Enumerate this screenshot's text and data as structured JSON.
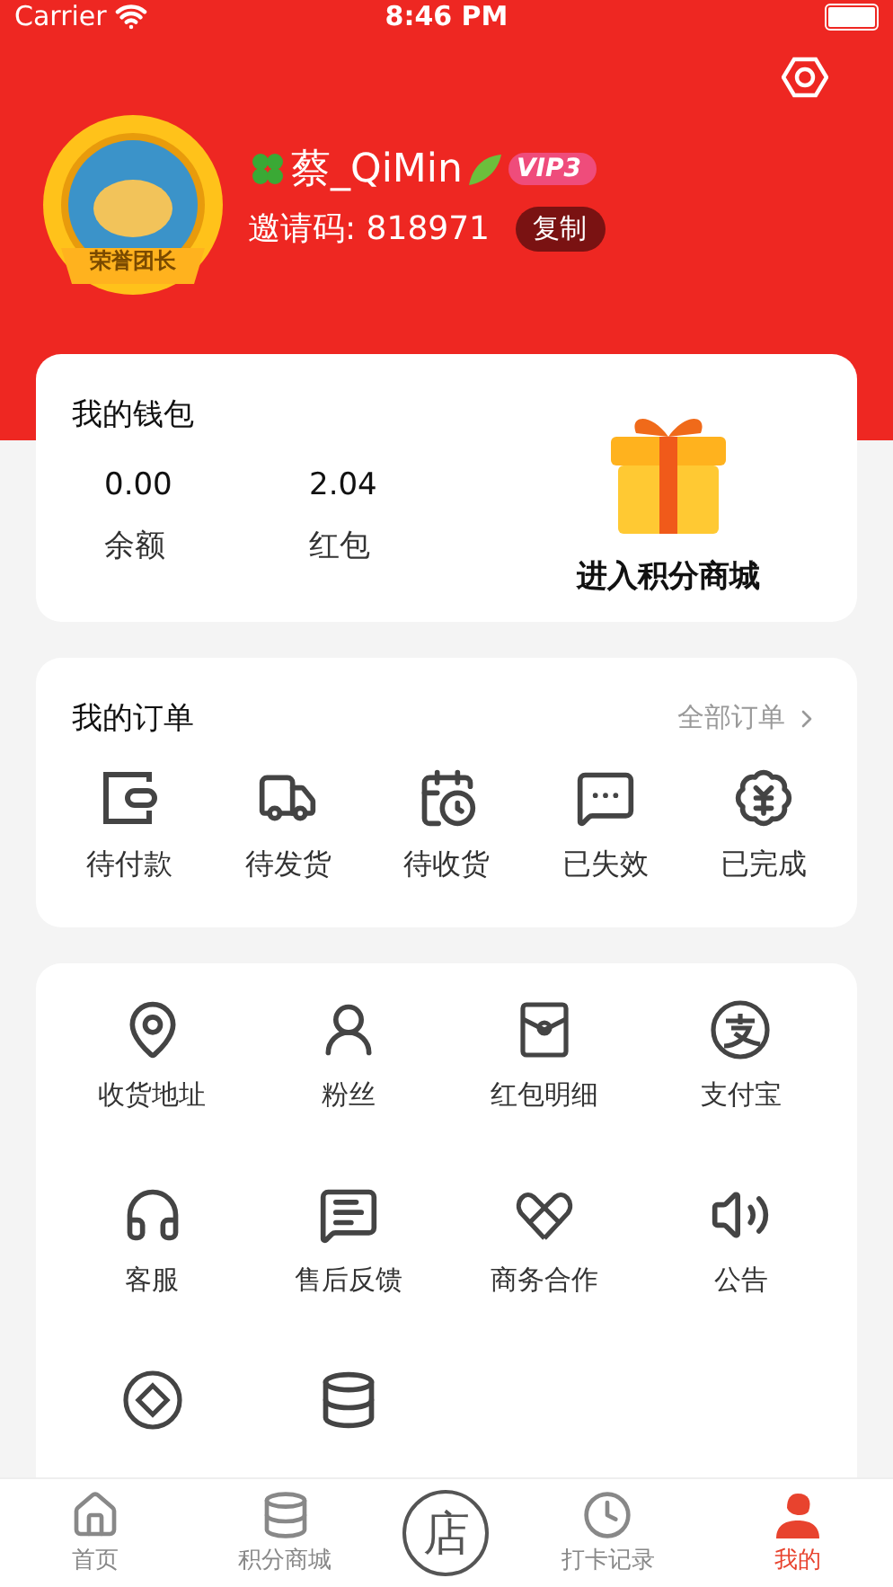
{
  "status_bar": {
    "carrier": "Carrier",
    "time": "8:46 PM"
  },
  "profile": {
    "badge_text": "荣誉团长",
    "name": "蔡_QiMin",
    "vip": "VIP3",
    "invite_label": "邀请码: 818971",
    "copy_button": "复制"
  },
  "wallet": {
    "title": "我的钱包",
    "stats": [
      {
        "value": "0.00",
        "label": "余额"
      },
      {
        "value": "2.04",
        "label": "红包"
      }
    ],
    "mall_link": "进入积分商城"
  },
  "orders": {
    "title": "我的订单",
    "all_link": "全部订单",
    "items": [
      {
        "label": "待付款"
      },
      {
        "label": "待发货"
      },
      {
        "label": "待收货"
      },
      {
        "label": "已失效"
      },
      {
        "label": "已完成"
      }
    ]
  },
  "services": [
    {
      "label": "收货地址"
    },
    {
      "label": "粉丝"
    },
    {
      "label": "红包明细"
    },
    {
      "label": "支付宝"
    },
    {
      "label": "客服"
    },
    {
      "label": "售后反馈"
    },
    {
      "label": "商务合作"
    },
    {
      "label": "公告"
    }
  ],
  "tab_bar": [
    {
      "label": "首页",
      "selected": false
    },
    {
      "label": "积分商城",
      "selected": false
    },
    {
      "label": "店",
      "kind": "center",
      "selected": false
    },
    {
      "label": "打卡记录",
      "selected": false
    },
    {
      "label": "我的",
      "selected": true
    }
  ]
}
